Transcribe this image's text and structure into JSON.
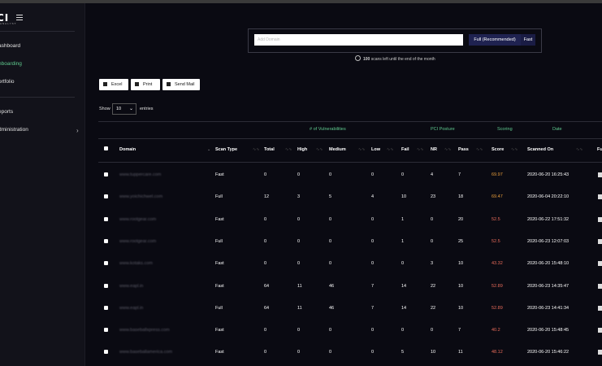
{
  "brand": {
    "logo_text": "CI",
    "logo_sub": "ANALYST"
  },
  "sidebar": {
    "items": [
      {
        "label": "ashboard"
      },
      {
        "label": "nboarding"
      },
      {
        "label": "ortfolio"
      },
      {
        "label": "eports"
      },
      {
        "label": "dministration"
      }
    ]
  },
  "search": {
    "placeholder": "Add Domain",
    "value": "",
    "full_label": "Full (Recommended)",
    "fast_label": "Fast",
    "scans_left": "100",
    "scans_note": "scans left until the end of the month"
  },
  "toolbar": {
    "excel_label": "Excel",
    "print_label": "Print",
    "send_mail_label": "Send Mail"
  },
  "length": {
    "show_label": "Show",
    "value": "10",
    "entries_label": "entries"
  },
  "table": {
    "groups": {
      "vulnerabilities": "# of Vulnerabilities",
      "pci": "PCI Posture",
      "scoring": "Scoring",
      "date": "Date"
    },
    "columns": {
      "domain": "Domain",
      "scan_type": "Scan Type",
      "total": "Total",
      "high": "High",
      "medium": "Medium",
      "low": "Low",
      "fail": "Fail",
      "nr": "NR",
      "pass": "Pass",
      "score": "Score",
      "scanned_on": "Scanned On",
      "extra": "Fu"
    },
    "rows": [
      {
        "domain": "www.tuppercare.com",
        "scan_type": "Fast",
        "total": "0",
        "high": "0",
        "medium": "0",
        "low": "0",
        "fail": "0",
        "nr": "4",
        "pass": "7",
        "score": "69.97",
        "score_color": "#e59b3a",
        "scanned_on": "2020-06-20 16:25:43"
      },
      {
        "domain": "www.yoichichwel.com",
        "scan_type": "Full",
        "total": "12",
        "high": "3",
        "medium": "5",
        "low": "4",
        "fail": "10",
        "nr": "23",
        "pass": "18",
        "score": "69.47",
        "score_color": "#e59b3a",
        "scanned_on": "2020-06-04 20:22:10"
      },
      {
        "domain": "www.rootgear.com",
        "scan_type": "Fast",
        "total": "0",
        "high": "0",
        "medium": "0",
        "low": "0",
        "fail": "1",
        "nr": "0",
        "pass": "20",
        "score": "52.5",
        "score_color": "#e86b5a",
        "scanned_on": "2020-06-22 17:51:32"
      },
      {
        "domain": "www.rootgear.com",
        "scan_type": "Full",
        "total": "0",
        "high": "0",
        "medium": "0",
        "low": "0",
        "fail": "1",
        "nr": "0",
        "pass": "25",
        "score": "52.5",
        "score_color": "#e86b5a",
        "scanned_on": "2020-06-23 12:07:03"
      },
      {
        "domain": "www.kotaks.com",
        "scan_type": "Fast",
        "total": "0",
        "high": "0",
        "medium": "0",
        "low": "0",
        "fail": "0",
        "nr": "3",
        "pass": "10",
        "score": "43.32",
        "score_color": "#e86b5a",
        "scanned_on": "2020-06-20 15:48:10"
      },
      {
        "domain": "www.eapl.in",
        "scan_type": "Fast",
        "total": "64",
        "high": "11",
        "medium": "46",
        "low": "7",
        "fail": "14",
        "nr": "22",
        "pass": "10",
        "score": "52.89",
        "score_color": "#e86b5a",
        "scanned_on": "2020-06-23 14:35:47"
      },
      {
        "domain": "www.eapl.in",
        "scan_type": "Full",
        "total": "64",
        "high": "11",
        "medium": "46",
        "low": "7",
        "fail": "14",
        "nr": "22",
        "pass": "10",
        "score": "52.89",
        "score_color": "#e86b5a",
        "scanned_on": "2020-06-23 14:41:34"
      },
      {
        "domain": "www.baseballxpress.com",
        "scan_type": "Fast",
        "total": "0",
        "high": "0",
        "medium": "0",
        "low": "0",
        "fail": "0",
        "nr": "0",
        "pass": "7",
        "score": "40.2",
        "score_color": "#e86b5a",
        "scanned_on": "2020-06-20 15:48:45"
      },
      {
        "domain": "www.baseballamerica.com",
        "scan_type": "Fast",
        "total": "0",
        "high": "0",
        "medium": "0",
        "low": "0",
        "fail": "5",
        "nr": "10",
        "pass": "11",
        "score": "48.12",
        "score_color": "#e86b5a",
        "scanned_on": "2020-06-20 15:46:22"
      }
    ]
  },
  "icons": {
    "menu": "hamburger-icon",
    "clock": "clock-icon",
    "excel": "file-excel-icon",
    "print": "printer-icon",
    "mail": "envelope-icon",
    "chevron": "chevron-right-icon",
    "report": "document-icon"
  },
  "colors": {
    "accent": "#5fc98e",
    "score_orange": "#e59b3a",
    "score_red": "#e86b5a",
    "scan_button": "#1f2250"
  }
}
